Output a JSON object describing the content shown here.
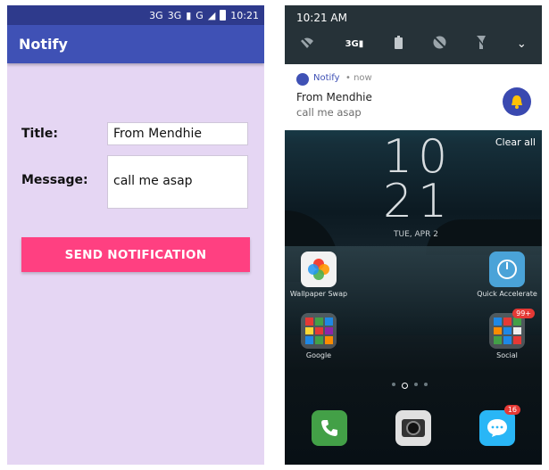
{
  "left": {
    "status": {
      "network": "3G",
      "network2": "3G",
      "network3": "G",
      "time": "10:21"
    },
    "app_title": "Notify",
    "form": {
      "title_label": "Title:",
      "title_value": "From Mendhie",
      "message_label": "Message:",
      "message_value": "call me asap"
    },
    "send_button": "SEND NOTIFICATION"
  },
  "right": {
    "time": "10:21 AM",
    "notification": {
      "app": "Notify",
      "when": "• now",
      "title": "From Mendhie",
      "text": "call me asap"
    },
    "clear_all": "Clear all",
    "clock": {
      "hour": "10",
      "minute": "21",
      "date": "TUE, APR 2"
    },
    "apps": [
      {
        "label": "Wallpaper Swap"
      },
      {
        "label": "Quick Accelerate"
      },
      {
        "label": "Google"
      },
      {
        "label": "Social",
        "badge": "99+"
      }
    ],
    "dock": [
      {
        "name": "phone"
      },
      {
        "name": "camera"
      },
      {
        "name": "messages",
        "badge": "16"
      }
    ]
  },
  "colors": {
    "primary": "#3f51b5",
    "status_bar": "#2e3a8c",
    "accent": "#ff4081",
    "background": "#e5d6f3"
  }
}
